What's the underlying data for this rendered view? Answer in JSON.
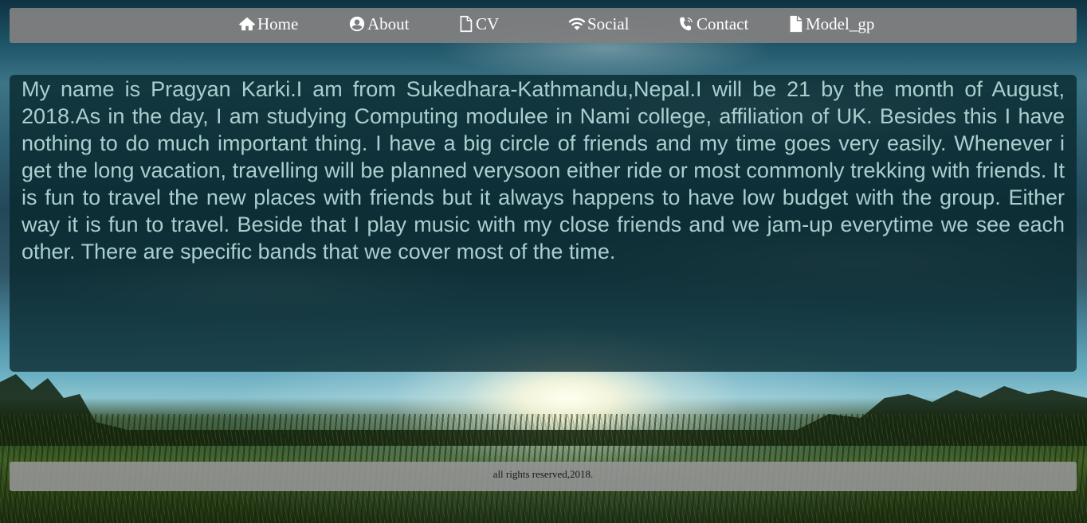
{
  "nav": {
    "items": [
      {
        "label": "Home",
        "icon": "home-icon"
      },
      {
        "label": "About",
        "icon": "user-circle-icon"
      },
      {
        "label": "CV",
        "icon": "file-outline-icon"
      },
      {
        "label": "Social",
        "icon": "wifi-icon"
      },
      {
        "label": "Contact",
        "icon": "phone-icon"
      },
      {
        "label": "Model_gp",
        "icon": "document-icon"
      }
    ]
  },
  "main": {
    "bio_text": "My name is Pragyan Karki.I am from Sukedhara-Kathmandu,Nepal.I will be 21 by the month of August, 2018.As in the day, I am studying Computing modulee in Nami college, affiliation of UK. Besides this I have nothing to do much important thing. I have a big circle of friends and my time goes very easily. Whenever i get the long vacation, travelling will be planned verysoon either ride or most commonly trekking with friends. It is fun to travel the new places with friends but it always happens to have low budget with the group. Either way it is fun to travel. Beside that I play music with my close friends and we jam-up everytime we see each other. There are specific bands that we cover most of the time."
  },
  "footer": {
    "text": "all rights reserved,2018."
  },
  "colors": {
    "navbar_bg": "#808080",
    "content_text": "#a9cfcf",
    "content_bg": "#08262c"
  }
}
